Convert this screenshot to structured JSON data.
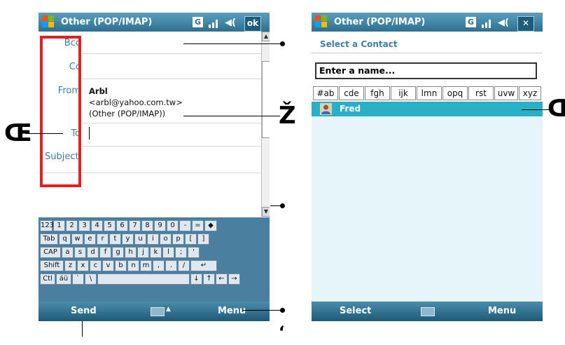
{
  "left_screen": {
    "title": "Other (POP/IMAP)",
    "tray": {
      "g": "G",
      "ok": "ok"
    },
    "fields": {
      "bcc": "Bcc",
      "cc": "Cc",
      "from": "From",
      "to": "To",
      "subject": "Subject:"
    },
    "from_lines": [
      "Arbl",
      "<arbl@yahoo.com.tw>",
      "(Other (POP/IMAP))"
    ],
    "keyboard_rows": [
      [
        "123",
        "1",
        "2",
        "3",
        "4",
        "5",
        "6",
        "7",
        "8",
        "9",
        "0",
        "-",
        "=",
        "◆"
      ],
      [
        "Tab",
        "q",
        "w",
        "e",
        "r",
        "t",
        "y",
        "u",
        "i",
        "o",
        "p",
        "[",
        "]"
      ],
      [
        "CAP",
        "a",
        "s",
        "d",
        "f",
        "g",
        "h",
        "j",
        "k",
        "l",
        ";",
        "'"
      ],
      [
        "Shift",
        "z",
        "x",
        "c",
        "v",
        "b",
        "n",
        "m",
        ",",
        ".",
        "/",
        "↵"
      ],
      [
        "Ctl",
        "áü",
        "`",
        "\\",
        "",
        "↓",
        "↑",
        "←",
        "→"
      ]
    ],
    "softkeys": {
      "left": "Send",
      "right": "Menu"
    }
  },
  "right_screen": {
    "title": "Other (POP/IMAP)",
    "tray": {
      "g": "G",
      "close": "✕"
    },
    "header": "Select a Contact",
    "input_value": "Enter a name...",
    "tabs": [
      "#ab",
      "cde",
      "fgh",
      "ijk",
      "lmn",
      "opq",
      "rst",
      "uvw",
      "xyz"
    ],
    "contacts": [
      {
        "name": "Fred"
      }
    ],
    "softkeys": {
      "left": "Select",
      "right": "Menu"
    }
  },
  "callouts": {
    "to_marker": "Œ",
    "from_marker": "Ž",
    "contact_marker": "Œ",
    "softkey_marker": "‘"
  },
  "colors": {
    "titlebar": "#2d6f8f",
    "highlight": "#29b0c7",
    "label_blue": "#3b7fa6",
    "annotation_red": "#e3201f"
  },
  "icons": [
    "windows-logo-icon",
    "g-icon",
    "signal-icon",
    "speaker-icon",
    "keyboard-icon",
    "contact-person-icon"
  ]
}
